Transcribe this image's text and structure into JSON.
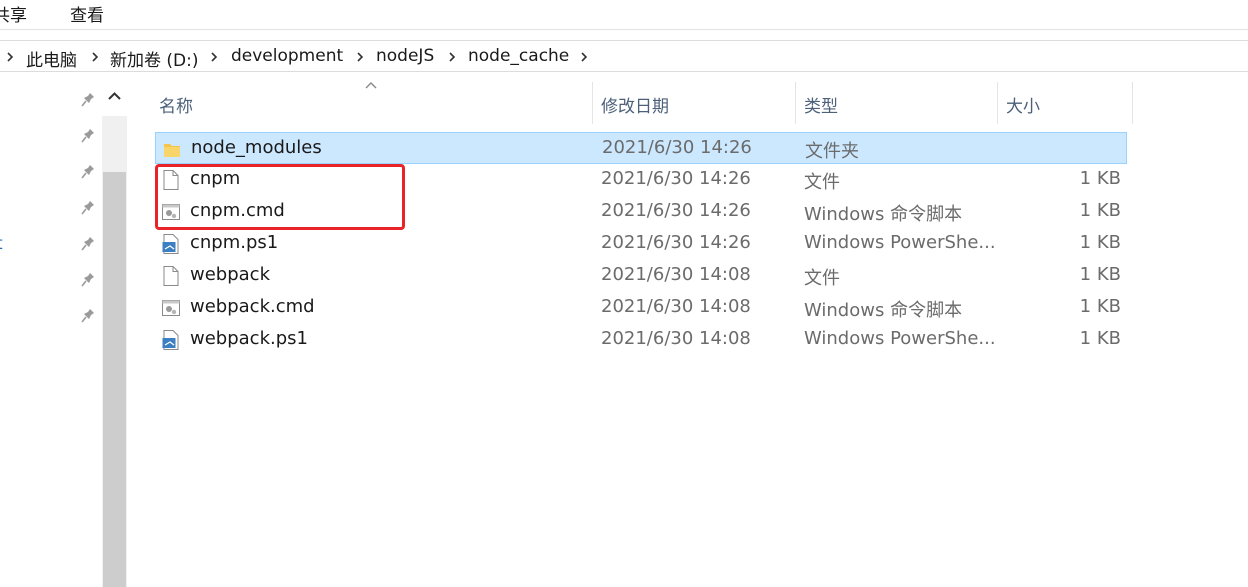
{
  "ribbon": {
    "share_label": "共享",
    "view_label": "查看"
  },
  "breadcrumb": [
    {
      "label": "此电脑"
    },
    {
      "label": "新加卷 (D:)"
    },
    {
      "label": "development"
    },
    {
      "label": "nodeJS"
    },
    {
      "label": "node_cache"
    }
  ],
  "columns": {
    "name": "名称",
    "modified": "修改日期",
    "type": "类型",
    "size": "大小"
  },
  "files": [
    {
      "name": "node_modules",
      "modified": "2021/6/30 14:26",
      "type": "文件夹",
      "size": "",
      "icon": "folder-icon",
      "selected": true
    },
    {
      "name": "cnpm",
      "modified": "2021/6/30 14:26",
      "type": "文件",
      "size": "1 KB",
      "icon": "file-icon"
    },
    {
      "name": "cnpm.cmd",
      "modified": "2021/6/30 14:26",
      "type": "Windows 命令脚本",
      "size": "1 KB",
      "icon": "cmd-script-icon"
    },
    {
      "name": "cnpm.ps1",
      "modified": "2021/6/30 14:26",
      "type": "Windows PowerShe...",
      "size": "1 KB",
      "icon": "powershell-script-icon"
    },
    {
      "name": "webpack",
      "modified": "2021/6/30 14:08",
      "type": "文件",
      "size": "1 KB",
      "icon": "file-icon"
    },
    {
      "name": "webpack.cmd",
      "modified": "2021/6/30 14:08",
      "type": "Windows 命令脚本",
      "size": "1 KB",
      "icon": "cmd-script-icon"
    },
    {
      "name": "webpack.ps1",
      "modified": "2021/6/30 14:08",
      "type": "Windows PowerShe...",
      "size": "1 KB",
      "icon": "powershell-script-icon"
    }
  ],
  "navpane": {
    "edge_char": "t"
  },
  "colors": {
    "selection_bg": "#cce8ff",
    "selection_border": "#99d1ff",
    "annotation": "#e8232a",
    "folder": "#f3c64b"
  }
}
